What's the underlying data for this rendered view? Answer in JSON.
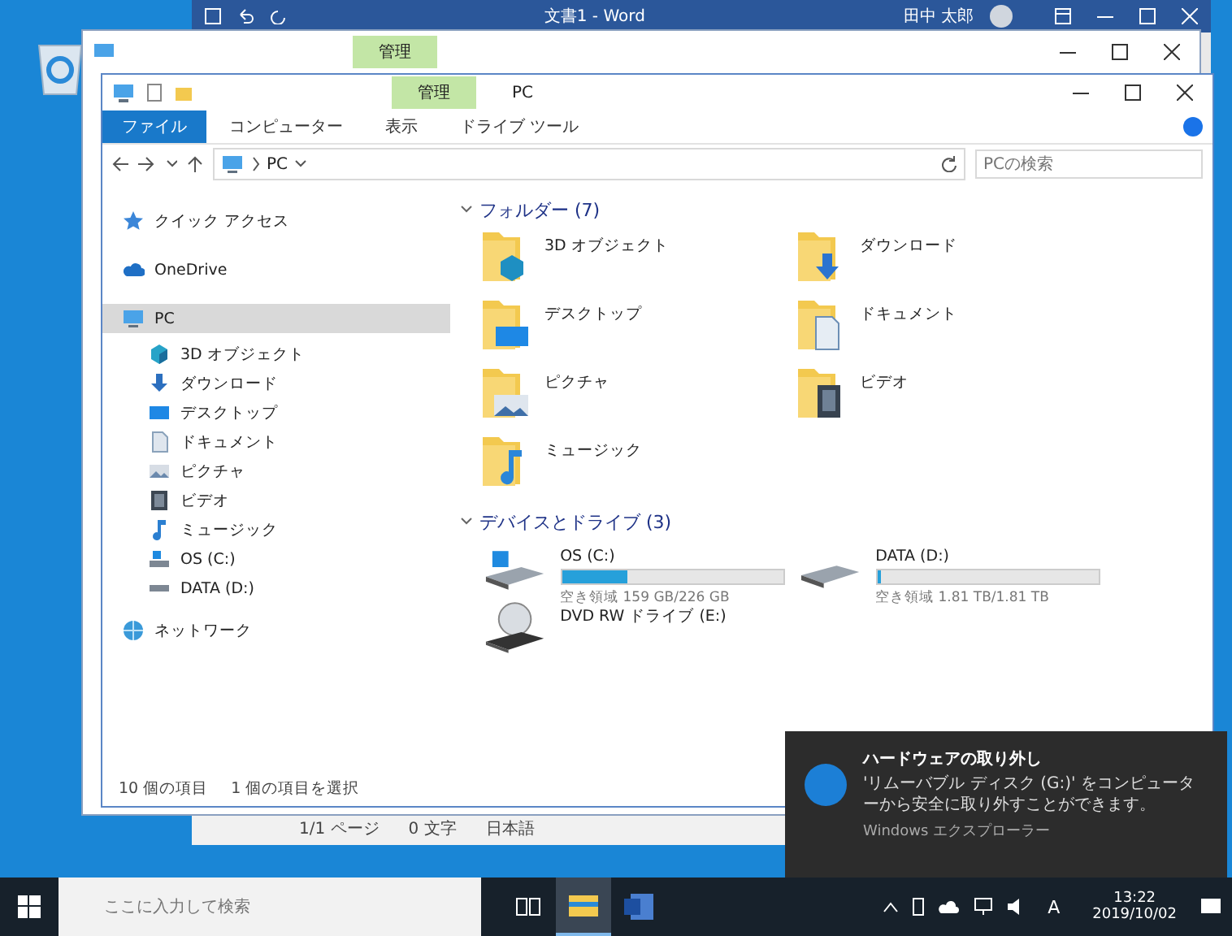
{
  "word_window": {
    "title": "文書1 - Word",
    "user": "田中 太郎",
    "status_bar": [
      "1/1 ページ",
      "0 文字",
      "日本語"
    ]
  },
  "back_explorer": {
    "context_tab": "管理"
  },
  "explorer": {
    "title": "PC",
    "context_tab": "管理",
    "ribbon_tabs": [
      {
        "label": "ファイル",
        "selected": true
      },
      {
        "label": "コンピューター",
        "selected": false
      },
      {
        "label": "表示",
        "selected": false
      },
      {
        "label": "ドライブ ツール",
        "selected": false
      }
    ],
    "address": {
      "path": "PC",
      "search_placeholder": "PCの検索"
    },
    "sidebar": {
      "items": [
        {
          "label": "クイック アクセス",
          "selected": false
        },
        {
          "label": "OneDrive",
          "selected": false
        },
        {
          "label": "PC",
          "selected": true,
          "children": [
            {
              "label": "3D オブジェクト",
              "selected": false
            },
            {
              "label": "ダウンロード",
              "selected": false
            },
            {
              "label": "デスクトップ",
              "selected": false
            },
            {
              "label": "ドキュメント",
              "selected": false
            },
            {
              "label": "ピクチャ",
              "selected": false
            },
            {
              "label": "ビデオ",
              "selected": false
            },
            {
              "label": "ミュージック",
              "selected": false
            },
            {
              "label": "OS (C:)",
              "selected": false
            },
            {
              "label": "DATA (D:)",
              "selected": false
            }
          ]
        },
        {
          "label": "ネットワーク",
          "selected": false
        }
      ]
    },
    "sections": [
      {
        "title": "フォルダー (7)",
        "expanded": true,
        "items": [
          {
            "kind": "folder",
            "label": "3D オブジェクト"
          },
          {
            "kind": "folder",
            "label": "ダウンロード"
          },
          {
            "kind": "folder",
            "label": "デスクトップ"
          },
          {
            "kind": "folder",
            "label": "ドキュメント"
          },
          {
            "kind": "folder",
            "label": "ピクチャ"
          },
          {
            "kind": "folder",
            "label": "ビデオ"
          },
          {
            "kind": "folder",
            "label": "ミュージック"
          }
        ]
      },
      {
        "title": "デバイスとドライブ (3)",
        "expanded": true,
        "items": [
          {
            "kind": "osdrive",
            "label": "OS (C:)",
            "level": 0.3,
            "free": "空き領域 159 GB/226 GB"
          },
          {
            "kind": "drive",
            "label": "DATA (D:)",
            "level": 0.02,
            "free": "空き領域 1.81 TB/1.81 TB"
          },
          {
            "kind": "dvd",
            "label": "DVD RW ドライブ (E:)"
          }
        ]
      }
    ],
    "status_bar": [
      "10 個の項目",
      "1 個の項目を選択"
    ]
  },
  "notification": {
    "title": "ハードウェアの取り外し",
    "message": "'リムーバブル ディスク (G:)' をコンピューターから安全に取り外すことができます。",
    "source": "Windows エクスプローラー"
  },
  "taskbar": {
    "search_placeholder": "ここに入力して検索",
    "apps": [
      {
        "kind": "taskview",
        "selected": false
      },
      {
        "kind": "explorer",
        "selected": true
      },
      {
        "kind": "word",
        "selected": false
      }
    ],
    "ime": "A",
    "time": "13:22",
    "date": "2019/10/02"
  }
}
